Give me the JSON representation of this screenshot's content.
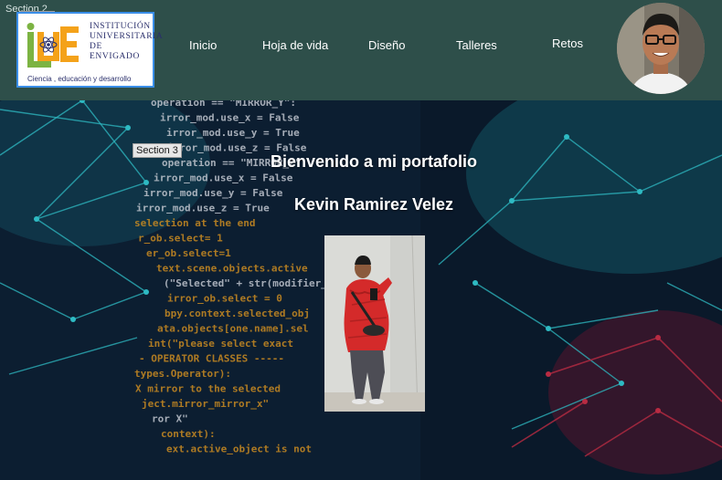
{
  "sections": {
    "section2_label": "Section 2",
    "section3_label": "Section 3"
  },
  "logo": {
    "initials": "IUE",
    "title_lines": [
      "INSTITUCIÓN",
      "UNIVERSITARIA",
      "DE ENVIGADO"
    ],
    "tagline": "Ciencia , educación y desarrollo"
  },
  "nav": {
    "items": [
      {
        "label": "Inicio"
      },
      {
        "label": "Hoja de vida"
      },
      {
        "label": "Diseño"
      },
      {
        "label": "Talleres"
      },
      {
        "label": "Retos"
      }
    ]
  },
  "hero": {
    "title": "Bienvenido a mi portafolio",
    "name": "Kevin Ramirez Velez",
    "code_lines": [
      "operation == \"MIRROR_Y\":",
      "irror_mod.use_x = False",
      "irror_mod.use_y = True",
      "irror_mod.use_z = False",
      "operation == \"MIRROR_Z\":",
      "irror_mod.use_x = False",
      "irror_mod.use_y = False",
      "irror_mod.use_z = True",
      "selection at the end",
      "r_ob.select= 1",
      "er_ob.select=1",
      "text.scene.objects.active",
      "(\"Selected\" + str(modifier_",
      "irror_ob.select = 0",
      "bpy.context.selected_obj",
      "ata.objects[one.name].sel",
      "int(\"please select exact",
      "- OPERATOR CLASSES -----",
      "types.Operator):",
      "X mirror to the selected",
      "ject.mirror_mirror_x\"",
      "ror X\"",
      "context):",
      "ext.active_object is not"
    ]
  },
  "colors": {
    "header_bg": "#2e4f4a",
    "logo_navy": "#2a2f6b",
    "logo_green": "#7cb342",
    "logo_orange": "#f4a21a",
    "code_orange": "#f5a623",
    "code_white": "#e8edf5",
    "network_cyan": "#38e0e8",
    "network_red": "#e0314b"
  }
}
